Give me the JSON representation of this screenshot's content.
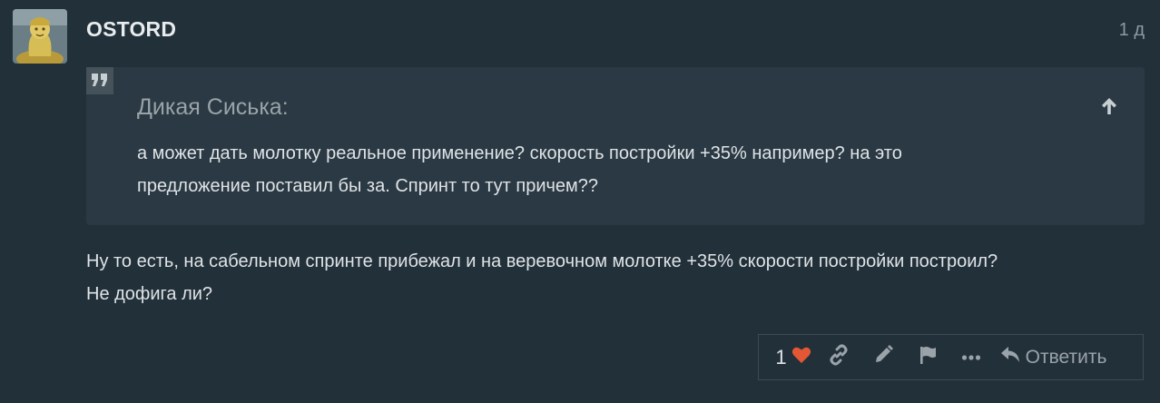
{
  "post": {
    "username": "OSTORD",
    "date": "1 д",
    "quote": {
      "author": "Дикая Сиська:",
      "line1": "а может дать молотку реальное применение? скорость постройки +35% например? на это",
      "line2": "предложение поставил бы за. Спринт то тут причем??"
    },
    "body": {
      "line1": "Ну то есть, на сабельном спринте прибежал и на веревочном молотке +35% скорости постройки построил?",
      "line2": "Не дофига ли?"
    },
    "actions": {
      "like_count": "1",
      "reply_label": "Ответить"
    }
  },
  "icons": {
    "avatar": "avatar-image",
    "quote": "quote-icon",
    "expand": "arrow-up-icon",
    "like": "heart-icon",
    "link": "link-icon",
    "edit": "pencil-icon",
    "flag": "flag-icon",
    "more": "ellipsis-icon",
    "reply": "reply-icon"
  },
  "colors": {
    "background": "#22303a",
    "quote_background": "#2a3943",
    "heart": "#e45735",
    "muted": "#9aa3a9"
  }
}
